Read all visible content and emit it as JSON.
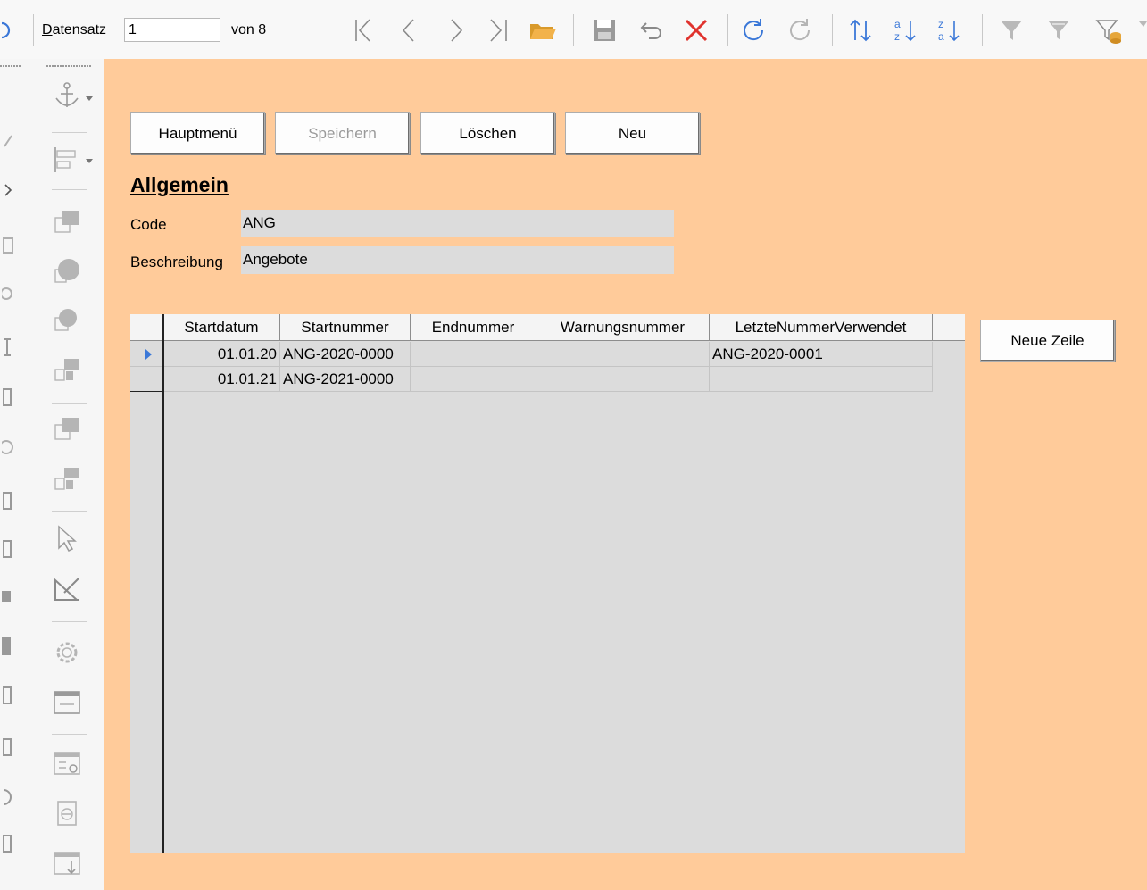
{
  "navigation": {
    "record_label": "Datensatz",
    "record_label_accel": "D",
    "record_label_rest": "atensatz",
    "record_value": "1",
    "record_of": "von 8"
  },
  "icons": {
    "first": "first-record-icon",
    "prev": "previous-record-icon",
    "next": "next-record-icon",
    "last": "last-record-icon",
    "new": "new-record-folder-icon",
    "save": "save-icon",
    "undo": "undo-icon",
    "delete": "delete-icon",
    "refresh": "refresh-icon",
    "refresh_control": "refresh-control-icon",
    "sort": "sort-icon",
    "sort_asc": "sort-ascending-icon",
    "sort_desc": "sort-descending-icon",
    "autofilter": "autofilter-icon",
    "standard_filter": "standard-filter-icon",
    "apply_filter": "apply-filter-icon"
  },
  "colors": {
    "form_background": "#ffcb9a",
    "grid_background": "#dcdcdc",
    "field_background": "#dcdcdc",
    "accent_blue": "#3b78d8",
    "delete_red": "#e0332e",
    "folder_orange": "#f2b24a"
  },
  "buttons": {
    "main_menu": "Hauptmenü",
    "save": "Speichern",
    "delete": "Löschen",
    "new": "Neu",
    "new_row": "Neue Zeile"
  },
  "section": {
    "heading": "Allgemein"
  },
  "fields": {
    "code_label": "Code",
    "code_value": "ANG",
    "description_label": "Beschreibung",
    "description_value": "Angebote"
  },
  "grid": {
    "columns": [
      "Startdatum",
      "Startnummer",
      "Endnummer",
      "Warnungsnummer",
      "LetzteNummerVerwendet"
    ],
    "rows": [
      [
        "01.01.20",
        "ANG-2020-0000",
        "",
        "",
        "ANG-2020-0001"
      ],
      [
        "01.01.21",
        "ANG-2021-0000",
        "",
        "",
        ""
      ]
    ]
  }
}
